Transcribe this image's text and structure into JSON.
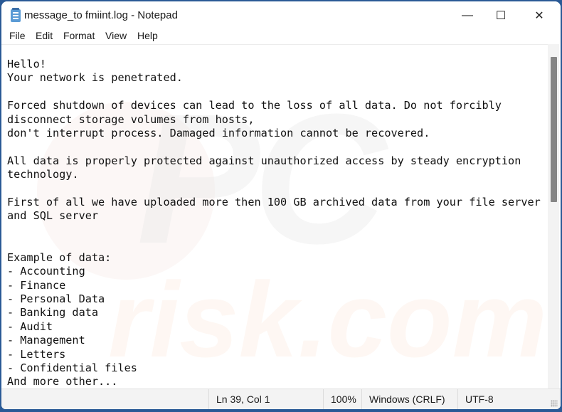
{
  "window": {
    "title": "message_to fmiint.log - Notepad",
    "icon": "notepad-icon",
    "controls": {
      "minimize": "—",
      "maximize": "☐",
      "close": "✕"
    }
  },
  "menu": {
    "items": [
      {
        "label": "File"
      },
      {
        "label": "Edit"
      },
      {
        "label": "Format"
      },
      {
        "label": "View"
      },
      {
        "label": "Help"
      }
    ]
  },
  "document": {
    "text": "Hello!\nYour network is penetrated.\n\nForced shutdown of devices can lead to the loss of all data. Do not forcibly\ndisconnect storage volumes from hosts,\ndon't interrupt process. Damaged information cannot be recovered.\n\nAll data is properly protected against unauthorized access by steady encryption\ntechnology.\n\nFirst of all we have uploaded more then 100 GB archived data from your file server\nand SQL server\n\n\nExample of data:\n- Accounting\n- Finance\n- Personal Data\n- Banking data\n- Audit\n- Management\n- Letters\n- Confidential files\nAnd more other..."
  },
  "watermark": {
    "top": "PC",
    "bottom": "risk.com"
  },
  "statusbar": {
    "position": "Ln 39, Col 1",
    "zoom": "100%",
    "line_ending": "Windows (CRLF)",
    "encoding": "UTF-8"
  },
  "scroll": {
    "thumb_position_fraction": 0.0,
    "visible_fraction": 0.44
  }
}
